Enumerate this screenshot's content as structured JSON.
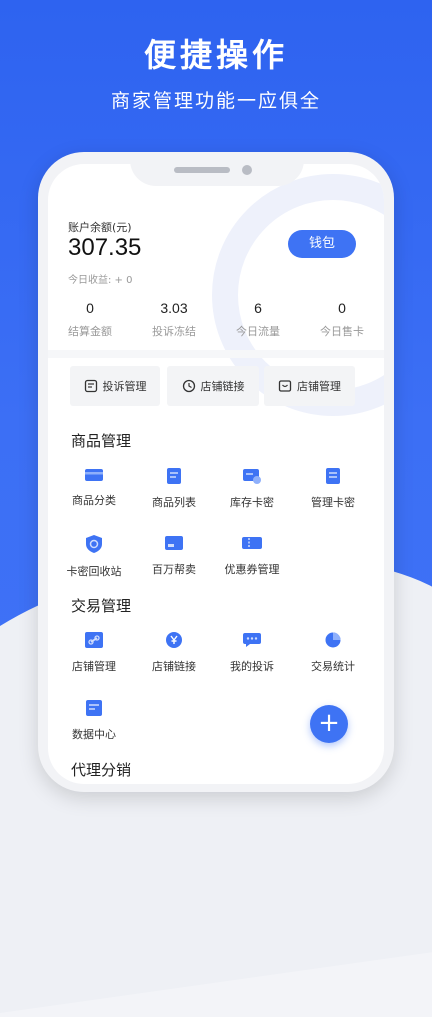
{
  "hero": {
    "title": "便捷操作",
    "subtitle": "商家管理功能一应俱全"
  },
  "colors": {
    "primary": "#3e73f4",
    "hero_bg": "#3468f2"
  },
  "account": {
    "balance_label": "账户余额(元)",
    "balance_value": "307.35",
    "today_income": "今日收益: + 0",
    "wallet_button": "钱包"
  },
  "stats": [
    {
      "value": "0",
      "label": "结算金额"
    },
    {
      "value": "3.03",
      "label": "投诉冻结"
    },
    {
      "value": "6",
      "label": "今日流量"
    },
    {
      "value": "0",
      "label": "今日售卡"
    }
  ],
  "quick_actions": [
    {
      "label": "投诉管理",
      "icon": "complaint-icon"
    },
    {
      "label": "店铺链接",
      "icon": "clock-link-icon"
    },
    {
      "label": "店铺管理",
      "icon": "store-icon"
    }
  ],
  "goods_section": {
    "title": "商品管理",
    "items": [
      {
        "label": "商品分类",
        "icon": "card-icon"
      },
      {
        "label": "商品列表",
        "icon": "list-icon"
      },
      {
        "label": "库存卡密",
        "icon": "stock-card-icon"
      },
      {
        "label": "管理卡密",
        "icon": "manage-card-icon"
      },
      {
        "label": "卡密回收站",
        "icon": "shield-recycle-icon"
      },
      {
        "label": "百万帮卖",
        "icon": "sell-icon"
      },
      {
        "label": "优惠券管理",
        "icon": "coupon-icon"
      }
    ]
  },
  "trade_section": {
    "title": "交易管理",
    "items": [
      {
        "label": "店铺管理",
        "icon": "link-store-icon"
      },
      {
        "label": "店铺链接",
        "icon": "yen-icon"
      },
      {
        "label": "我的投诉",
        "icon": "chat-icon"
      },
      {
        "label": "交易统计",
        "icon": "pie-chart-icon"
      },
      {
        "label": "数据中心",
        "icon": "data-center-icon"
      }
    ]
  },
  "agent_section": {
    "title": "代理分销"
  },
  "fab": {
    "label": "+"
  }
}
